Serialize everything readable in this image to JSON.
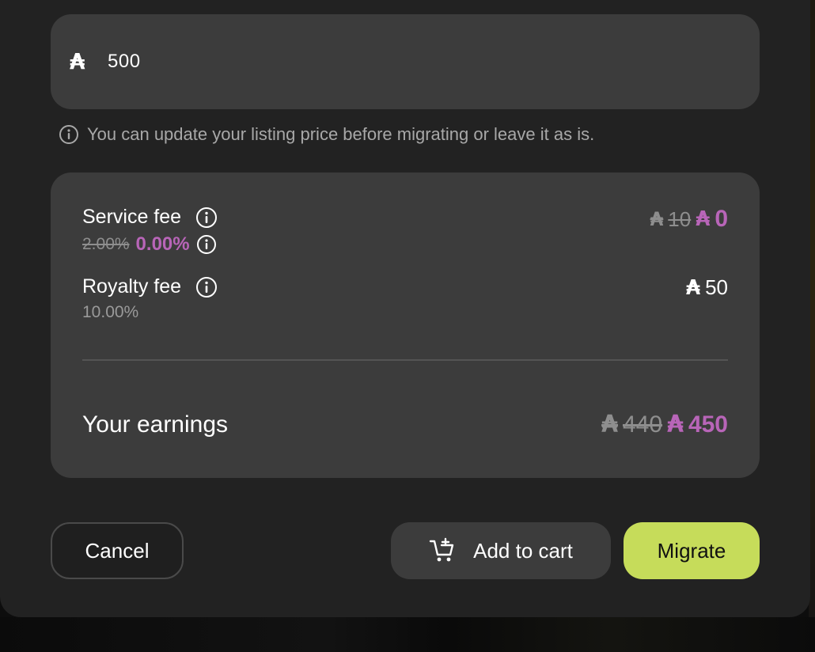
{
  "price_input": {
    "currency_symbol": "₳",
    "value": "500"
  },
  "hint": {
    "text": "You can update your listing price before migrating or leave it as is."
  },
  "fees": {
    "service_fee": {
      "label": "Service fee",
      "old_rate": "2.00%",
      "new_rate": "0.00%",
      "currency_symbol": "₳",
      "old_amount": "10",
      "new_amount": "0"
    },
    "royalty_fee": {
      "label": "Royalty fee",
      "rate": "10.00%",
      "currency_symbol": "₳",
      "amount": "50"
    }
  },
  "earnings": {
    "label": "Your earnings",
    "currency_symbol": "₳",
    "old_amount": "440",
    "new_amount": "450"
  },
  "actions": {
    "cancel_label": "Cancel",
    "add_to_cart_label": "Add to cart",
    "migrate_label": "Migrate"
  },
  "colors": {
    "accent": "#b865b8",
    "migrate_button": "#c6dc5a",
    "card_bg": "#3c3c3c",
    "modal_bg": "#222222"
  }
}
